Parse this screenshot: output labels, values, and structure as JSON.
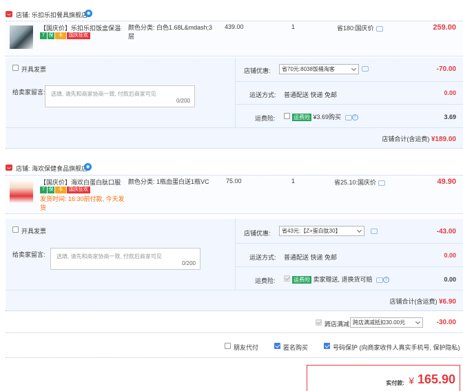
{
  "shops": [
    {
      "label": "店铺: 乐扣乐扣餐具旗舰店",
      "item": {
        "title": "【国庆价】乐扣乐扣饭盒保温桶...",
        "badges": [
          "7",
          "保",
          "卡",
          "国庆狂欢"
        ],
        "sku_line1": "颜色分类: 白色1.68L&mdash;3",
        "sku_line2": "层",
        "unit_price": "439.00",
        "quantity": "1",
        "saved": "省180:国庆价",
        "total": "259.00"
      },
      "invoice_label": "开具发票",
      "shop_discount_label": "店铺优惠:",
      "shop_discount_select": "省70元:8038饭桶淘客",
      "shop_discount_amount": "-70.00",
      "message_label": "给卖家留言:",
      "message_placeholder": "选填, 请先和商家协商一致, 付款后商家可见",
      "message_count": "0/200",
      "shipping_label": "运送方式:",
      "shipping_value": "普通配送 快递 免邮",
      "shipping_amount": "0.00",
      "insurance_label": "运费险:",
      "insurance_tag": "运费险",
      "insurance_text": "¥3.69购买",
      "insurance_amount": "3.69",
      "subtotal_label": "店铺合计(含运费)",
      "subtotal_value": "¥189.00"
    },
    {
      "label": "店铺: 海欢保健食品旗舰店",
      "item": {
        "title": "【国庆价】海欢白蛋白肽口服液...",
        "badges": [
          "7",
          "保",
          "卡",
          "国庆狂欢"
        ],
        "ship_note_line1": "发货时间: 16:30前付款, 今天发",
        "ship_note_line2": "货",
        "sku_line1": "颜色分类: 1瓶血蛋白送1瓶VC",
        "unit_price": "75.00",
        "quantity": "1",
        "saved": "省25.10:国庆价",
        "total": "49.90"
      },
      "invoice_label": "开具发票",
      "shop_discount_label": "店铺优惠:",
      "shop_discount_select": "省43元:【Z+蛋白肽30】",
      "shop_discount_amount": "-43.00",
      "message_label": "给卖家留言:",
      "message_placeholder": "选填, 请先和商家协商一致, 付款后商家可见",
      "message_count": "0/200",
      "shipping_label": "运送方式:",
      "shipping_value": "普通配送 快递 免邮",
      "shipping_amount": "0.00",
      "insurance_label": "运费险:",
      "insurance_tag": "运费险",
      "insurance_text": "卖家赠送, 退换货可赔",
      "insurance_amount": "0.00",
      "subtotal_label": "店铺合计(含运费)",
      "subtotal_value": "¥6.90"
    }
  ],
  "cross_store": {
    "label": "跨店满减",
    "select": "跨店满减抵扣30.00元",
    "amount": "-30.00"
  },
  "footer_options": {
    "friend_pay": "朋友代付",
    "anonymous": "匿名购买",
    "privacy": "号码保护 (向商家收件人真实手机号, 保护隐私)"
  },
  "payment": {
    "label": "实付款:",
    "currency": "¥",
    "value": "165.90"
  },
  "colors": {
    "accent_red": "#e4393c",
    "panel_blue": "#f2f7ff",
    "check_blue": "#3d7fe2"
  }
}
